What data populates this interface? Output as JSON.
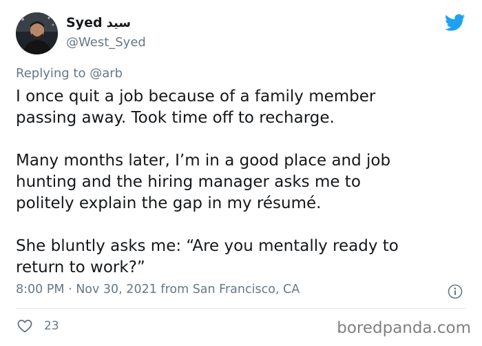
{
  "author": {
    "display_name": "Syed",
    "display_name_arabic": "سيد",
    "handle": "@West_Syed"
  },
  "reply": {
    "prefix": "Replying to",
    "mention": "@arb"
  },
  "tweet": {
    "paragraphs": [
      "I once quit a job because of a family member\npassing away. Took time off to recharge.",
      "Many months later, I’m in a good place and job\nhunting and the hiring manager asks me to\npolitely explain the gap in my résumé.",
      "She bluntly asks me: “Are you mentally ready to\nreturn to work?”"
    ],
    "meta": "8:00 PM · Nov 30, 2021 from San Francisco, CA"
  },
  "engagement": {
    "likes": "23"
  },
  "watermark": "boredpanda.com",
  "icons": {
    "brand": "twitter-bird-icon",
    "info": "info-icon",
    "like": "heart-icon"
  },
  "colors": {
    "twitter_blue": "#1da1f2",
    "secondary_text": "#657786",
    "primary_text": "#14171a",
    "divider": "#e1e8ed"
  }
}
